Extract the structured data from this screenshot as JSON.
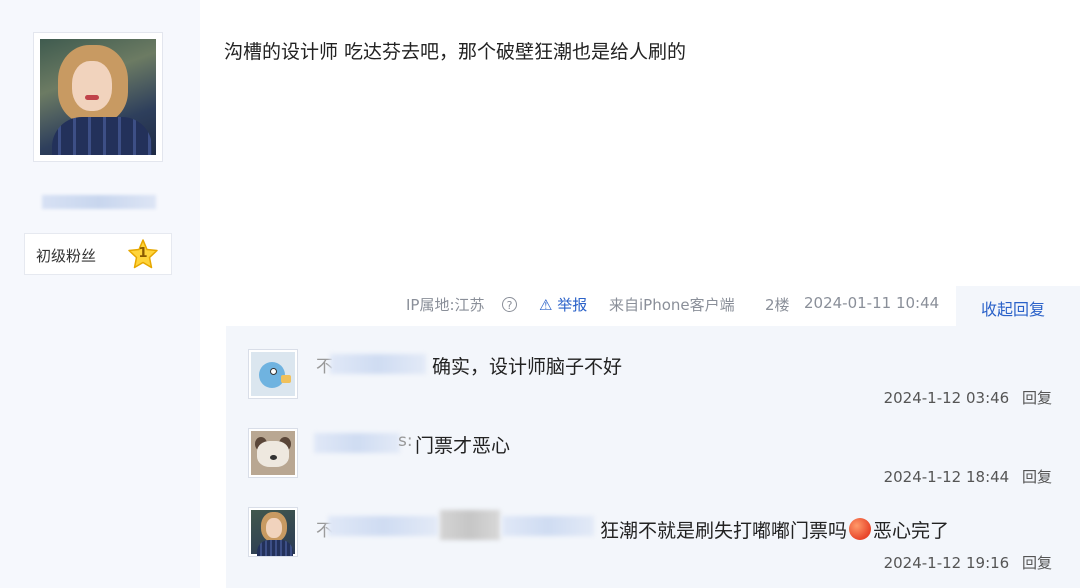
{
  "author": {
    "fan_level_label": "初级粉丝",
    "fan_level_number": "1"
  },
  "post": {
    "content": "沟槽的设计师 吃达芬去吧，那个破壁狂潮也是给人刷的",
    "ip_location": "IP属地:江苏",
    "help_icon_glyph": "?",
    "report_label": "举报",
    "client": "来自iPhone客户端",
    "floor": "2楼",
    "time": "2024-01-11 10:44",
    "collapse_reply_label": "收起回复"
  },
  "replies": [
    {
      "name_visible_prefix": "不",
      "text": "确实，设计师脑子不好",
      "time": "2024-1-12 03:46",
      "reply_label": "回复"
    },
    {
      "name_visible_suffix": "s:",
      "text": "门票才恶心",
      "time": "2024-1-12 18:44",
      "reply_label": "回复"
    },
    {
      "name_visible_prefix": "不",
      "text_before_emoji": "狂潮不就是刷失打嘟嘟门票吗",
      "text_after_emoji": "恶心完了",
      "time": "2024-1-12 19:16",
      "reply_label": "回复"
    }
  ],
  "icons": {
    "fan_badge": "star-badge-icon",
    "report": "warning-triangle-icon",
    "help": "question-circle-icon",
    "emoji": "angry-face-emoji-icon"
  },
  "colors": {
    "link": "#2b62c9",
    "meta": "#8a8f99",
    "reply_bg": "#f3f6fb",
    "sidebar_bg": "#f6f8fd"
  }
}
